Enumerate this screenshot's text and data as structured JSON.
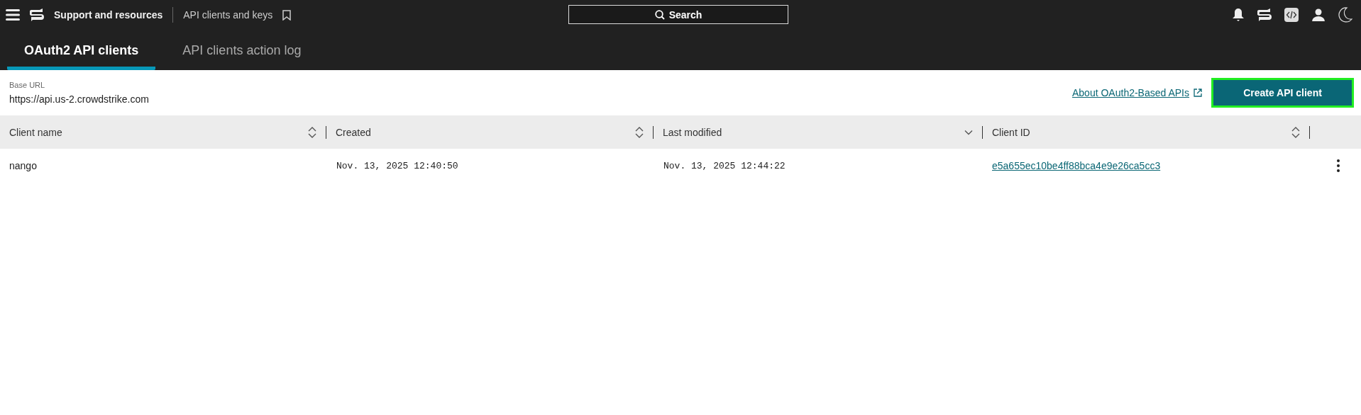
{
  "top_bar": {
    "app_title": "Support and resources",
    "breadcrumb": "API clients and keys",
    "search": {
      "placeholder": "Search"
    }
  },
  "tabs": [
    {
      "label": "OAuth2 API clients",
      "selected": true
    },
    {
      "label": "API clients action log",
      "selected": false
    }
  ],
  "base_url": {
    "label": "Base URL",
    "value": "https://api.us-2.crowdstrike.com"
  },
  "about_link": "About OAuth2-Based APIs",
  "create_button": {
    "label": "Create API client",
    "focused": true
  },
  "table": {
    "columns": [
      {
        "label": "Client name",
        "sorted": false
      },
      {
        "label": "Created",
        "sorted": false
      },
      {
        "label": "Last modified",
        "sorted": true
      },
      {
        "label": "Client ID",
        "sorted": false
      }
    ],
    "rows": [
      {
        "cells": [
          "nango",
          "Nov. 13, 2025 12:40:50",
          "Nov. 13, 2025 12:44:22",
          "e5a655ec10be4ff88bca4e9e26ca5cc3"
        ]
      }
    ]
  }
}
